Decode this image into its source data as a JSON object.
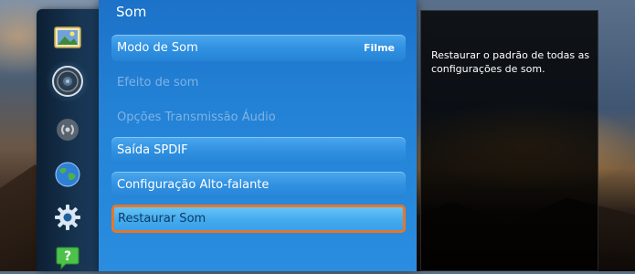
{
  "panel": {
    "title": "Som",
    "items": [
      {
        "label": "Modo de Som",
        "value": "Filme",
        "state": "enabled"
      },
      {
        "label": "Efeito de som",
        "value": "",
        "state": "disabled"
      },
      {
        "label": "Opções Transmissão Áudio",
        "value": "",
        "state": "disabled"
      },
      {
        "label": "Saída SPDIF",
        "value": "",
        "state": "enabled"
      },
      {
        "label": "Configuração Alto-falante",
        "value": "",
        "state": "enabled"
      },
      {
        "label": "Restaurar Som",
        "value": "",
        "state": "selected"
      }
    ]
  },
  "help": {
    "text": "Restaurar o padrão de todas as configurações de som."
  },
  "sidebar": {
    "icons": [
      "picture-icon",
      "speaker-icon",
      "broadcast-icon",
      "globe-icon",
      "gear-icon",
      "help-icon"
    ],
    "active": "speaker-icon"
  },
  "colors": {
    "panel": "#2382d6",
    "selection_border": "#e5762a",
    "help_background": "#000000"
  }
}
